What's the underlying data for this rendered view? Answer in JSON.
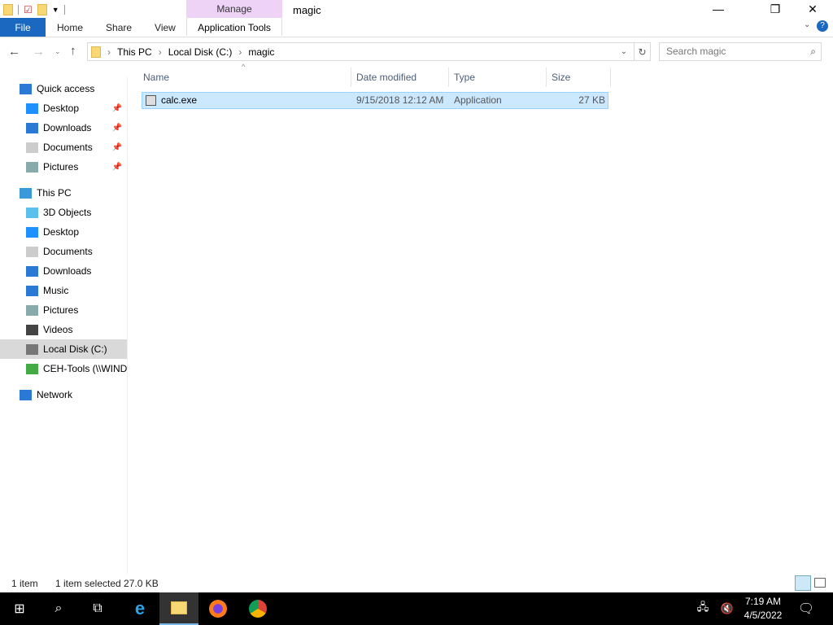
{
  "window": {
    "title": "magic",
    "context_tab": "Manage",
    "context_group": "Application Tools"
  },
  "ribbon": {
    "tabs": [
      "File",
      "Home",
      "Share",
      "View"
    ]
  },
  "address": {
    "crumbs": [
      "This PC",
      "Local Disk (C:)",
      "magic"
    ]
  },
  "search": {
    "placeholder": "Search magic"
  },
  "sidebar": {
    "items": [
      {
        "label": "Quick access",
        "icon": "star-icon"
      },
      {
        "label": "Desktop",
        "icon": "desktop-icon",
        "pinned": true
      },
      {
        "label": "Downloads",
        "icon": "download-icon",
        "pinned": true
      },
      {
        "label": "Documents",
        "icon": "documents-icon",
        "pinned": true
      },
      {
        "label": "Pictures",
        "icon": "pictures-icon",
        "pinned": true
      },
      {
        "label": "This PC",
        "icon": "computer-icon"
      },
      {
        "label": "3D Objects",
        "icon": "cube-icon"
      },
      {
        "label": "Desktop",
        "icon": "desktop-icon"
      },
      {
        "label": "Documents",
        "icon": "documents-icon"
      },
      {
        "label": "Downloads",
        "icon": "download-icon"
      },
      {
        "label": "Music",
        "icon": "music-icon"
      },
      {
        "label": "Pictures",
        "icon": "pictures-icon"
      },
      {
        "label": "Videos",
        "icon": "videos-icon"
      },
      {
        "label": "Local Disk (C:)",
        "icon": "drive-icon"
      },
      {
        "label": "CEH-Tools (\\\\WIND",
        "icon": "network-drive-icon"
      },
      {
        "label": "Network",
        "icon": "network-icon"
      }
    ]
  },
  "columns": [
    "Name",
    "Date modified",
    "Type",
    "Size"
  ],
  "files": [
    {
      "name": "calc.exe",
      "date": "9/15/2018 12:12 AM",
      "type": "Application",
      "size": "27 KB"
    }
  ],
  "status": {
    "count": "1 item",
    "selected": "1 item selected  27.0 KB"
  },
  "taskbar": {
    "time": "7:19 AM",
    "date": "4/5/2022"
  }
}
